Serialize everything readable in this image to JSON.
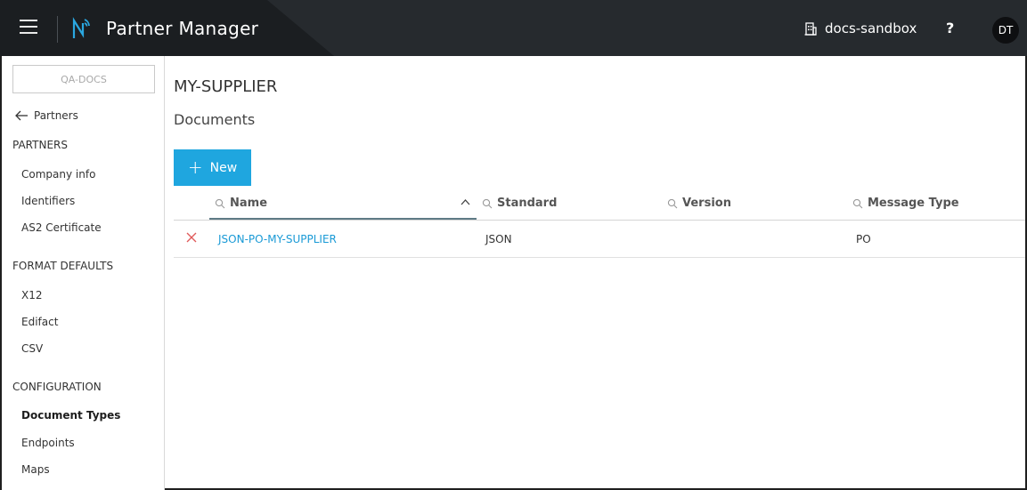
{
  "header": {
    "app_title": "Partner Manager",
    "environment": "docs-sandbox",
    "help": "?",
    "avatar_initials": "DT"
  },
  "sidebar": {
    "tenant": "QA-DOCS",
    "back_label": "Partners",
    "sections": {
      "partners": {
        "title": "PARTNERS",
        "items": [
          "Company info",
          "Identifiers",
          "AS2 Certificate"
        ]
      },
      "format_defaults": {
        "title": "FORMAT DEFAULTS",
        "items": [
          "X12",
          "Edifact",
          "CSV"
        ]
      },
      "configuration": {
        "title": "CONFIGURATION",
        "items": [
          "Document Types",
          "Endpoints",
          "Maps"
        ]
      }
    },
    "active_item": "Document Types"
  },
  "main": {
    "partner_name": "MY-SUPPLIER",
    "section_title": "Documents",
    "new_button": "New",
    "table": {
      "columns": [
        "Name",
        "Standard",
        "Version",
        "Message Type"
      ],
      "sort_column": "Name",
      "sort_direction": "ascending",
      "rows": [
        {
          "name": "JSON-PO-MY-SUPPLIER",
          "standard": "JSON",
          "version": "",
          "message_type": "PO"
        }
      ]
    }
  },
  "colors": {
    "topbar": "#262a2e",
    "accent": "#1fa6df",
    "link": "#1a9ad6",
    "delete": "#e05a5a"
  }
}
